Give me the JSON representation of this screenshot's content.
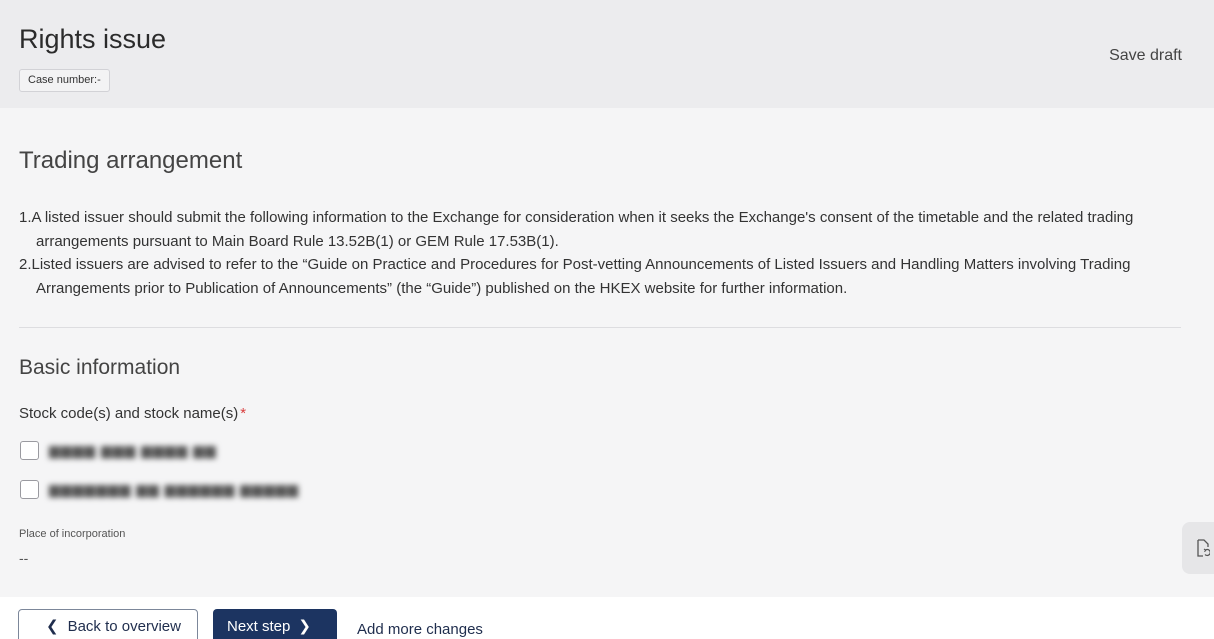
{
  "header": {
    "title": "Rights issue",
    "case_number": "Case number:-",
    "save_draft": "Save draft"
  },
  "section": {
    "title": "Trading arrangement",
    "notes": [
      "1.A listed issuer should submit the following information to the Exchange for consideration when it seeks the Exchange's consent of the timetable and the related trading arrangements pursuant to Main Board Rule 13.52B(1) or GEM Rule 17.53B(1).",
      "2.Listed issuers are advised to refer to the “Guide on Practice and Procedures for Post-vetting Announcements of Listed Issuers and Handling Matters involving Trading Arrangements prior to Publication of Announcements” (the “Guide”) published on the HKEX website for further information."
    ]
  },
  "basic_info": {
    "title": "Basic information",
    "stock_label": "Stock code(s) and stock name(s)",
    "required_mark": "*",
    "place_label": "Place of incorporation",
    "place_value": "--"
  },
  "side_tab": {
    "icon": "document-sync-icon"
  },
  "footer": {
    "back_label": "Back to overview",
    "next_label": "Next step",
    "add_changes_label": "Add more changes"
  },
  "colors": {
    "header_bg": "#ececee",
    "page_bg": "#f5f5f6",
    "primary_button": "#1c3461",
    "required": "#d93c3c"
  }
}
